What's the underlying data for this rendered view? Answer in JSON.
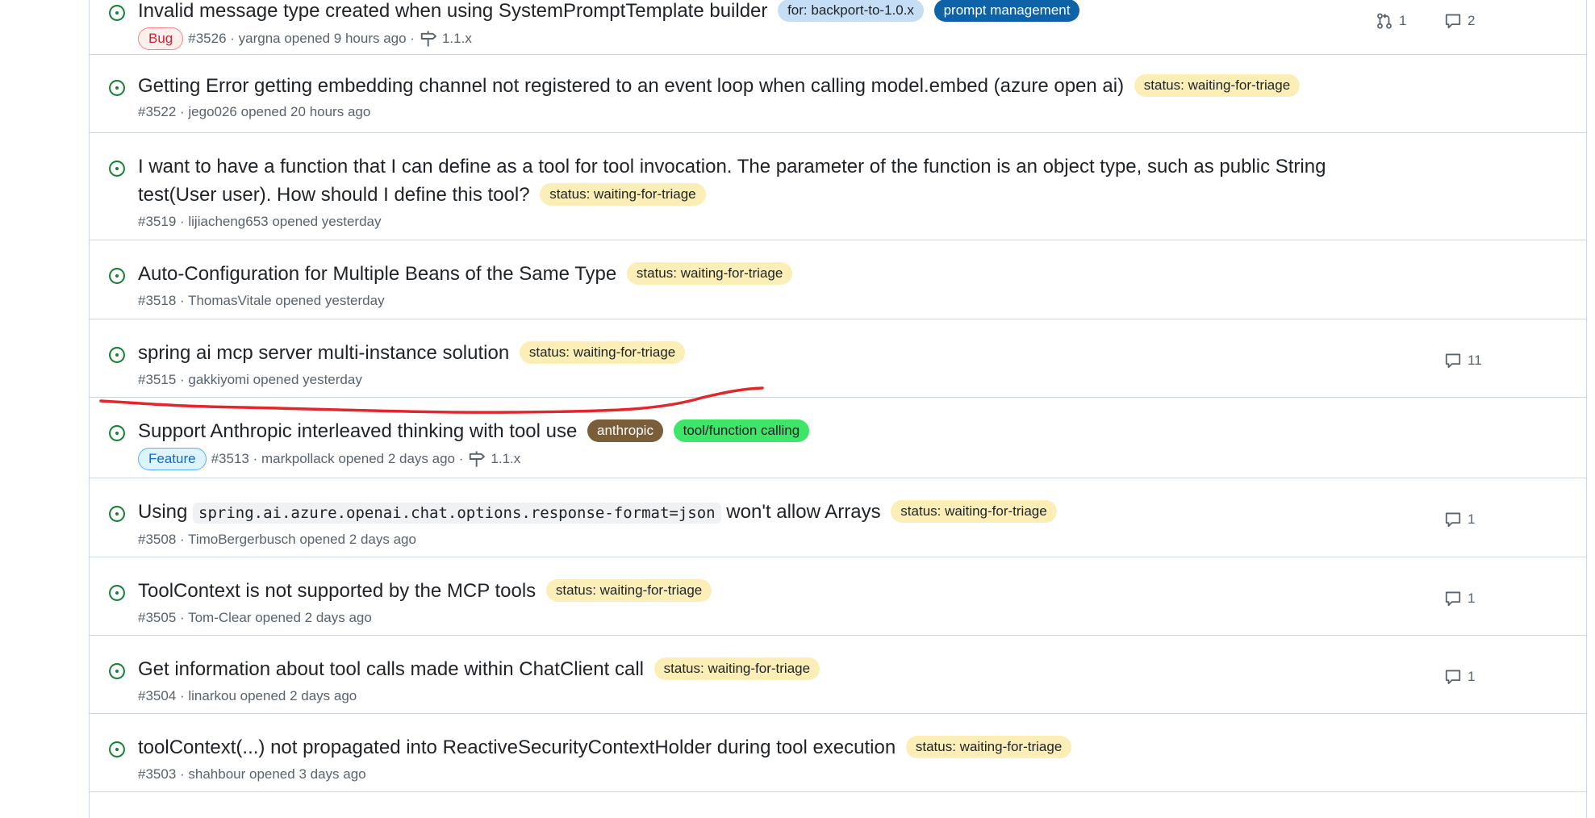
{
  "issues": [
    {
      "title": "Invalid message type created when using SystemPromptTemplate builder",
      "labels": [
        {
          "text": "for: backport-to-1.0.x",
          "bg": "#c5def5",
          "fg": "#1f2328"
        },
        {
          "text": "prompt management",
          "bg": "#0e62a8",
          "fg": "#ffffff"
        }
      ],
      "type_badge": "Bug",
      "meta": "#3526 · yargna opened 9 hours ago ·",
      "milestone": "1.1.x",
      "pr_count": "1",
      "comments": "2"
    },
    {
      "title": "Getting Error getting embedding channel not registered to an event loop when calling model.embed (azure open ai)",
      "labels": [
        {
          "text": "status: waiting-for-triage",
          "bg": "#fbeeb6",
          "fg": "#1f2328"
        }
      ],
      "meta": "#3522 · jego026 opened 20 hours ago"
    },
    {
      "title_line1": "I want to have a function that I can define as a tool for tool invocation. The parameter of the function is an object type, such as public String",
      "title_line2": "test(User user). How should I define this tool?",
      "labels": [
        {
          "text": "status: waiting-for-triage",
          "bg": "#fbeeb6",
          "fg": "#1f2328"
        }
      ],
      "meta": "#3519 · lijiacheng653 opened yesterday"
    },
    {
      "title": "Auto-Configuration for Multiple Beans of the Same Type",
      "labels": [
        {
          "text": "status: waiting-for-triage",
          "bg": "#fbeeb6",
          "fg": "#1f2328"
        }
      ],
      "meta": "#3518 · ThomasVitale opened yesterday"
    },
    {
      "title": "spring ai mcp server multi-instance solution",
      "labels": [
        {
          "text": "status: waiting-for-triage",
          "bg": "#fbeeb6",
          "fg": "#1f2328"
        }
      ],
      "meta": "#3515 · gakkiyomi opened yesterday",
      "comments": "11"
    },
    {
      "title": "Support Anthropic interleaved thinking with tool use",
      "labels": [
        {
          "text": "anthropic",
          "bg": "#7a5e3a",
          "fg": "#ffffff"
        },
        {
          "text": "tool/function calling",
          "bg": "#3ee566",
          "fg": "#1f2328"
        }
      ],
      "type_badge": "Feature",
      "meta": "#3513 · markpollack opened 2 days ago ·",
      "milestone": "1.1.x"
    },
    {
      "title_pre": "Using",
      "title_code": "spring.ai.azure.openai.chat.options.response-format=json",
      "title_post": "won't allow Arrays",
      "labels": [
        {
          "text": "status: waiting-for-triage",
          "bg": "#fbeeb6",
          "fg": "#1f2328"
        }
      ],
      "meta": "#3508 · TimoBergerbusch opened 2 days ago",
      "comments": "1"
    },
    {
      "title": "ToolContext is not supported by the MCP tools",
      "labels": [
        {
          "text": "status: waiting-for-triage",
          "bg": "#fbeeb6",
          "fg": "#1f2328"
        }
      ],
      "meta": "#3505 · Tom-Clear opened 2 days ago",
      "comments": "1"
    },
    {
      "title": "Get information about tool calls made within ChatClient call",
      "labels": [
        {
          "text": "status: waiting-for-triage",
          "bg": "#fbeeb6",
          "fg": "#1f2328"
        }
      ],
      "meta": "#3504 · linarkou opened 2 days ago",
      "comments": "1"
    },
    {
      "title": "toolContext(...) not propagated into ReactiveSecurityContextHolder during tool execution",
      "labels": [
        {
          "text": "status: waiting-for-triage",
          "bg": "#fbeeb6",
          "fg": "#1f2328"
        }
      ],
      "meta": "#3503 · shahbour opened 3 days ago"
    }
  ],
  "colors": {
    "open_icon": "#1a7f37",
    "bug_fg": "#d1242f",
    "bug_border": "#ff8182",
    "bug_bg": "#fff0ee",
    "feature_fg": "#0969da",
    "feature_border": "#54aeff",
    "feature_bg": "#ddf4ff",
    "annotation": "#e3262a"
  },
  "icons": {
    "open": "issue-opened-icon",
    "comment": "comment-icon",
    "pull_request": "git-pull-request-icon",
    "milestone": "milestone-icon"
  }
}
